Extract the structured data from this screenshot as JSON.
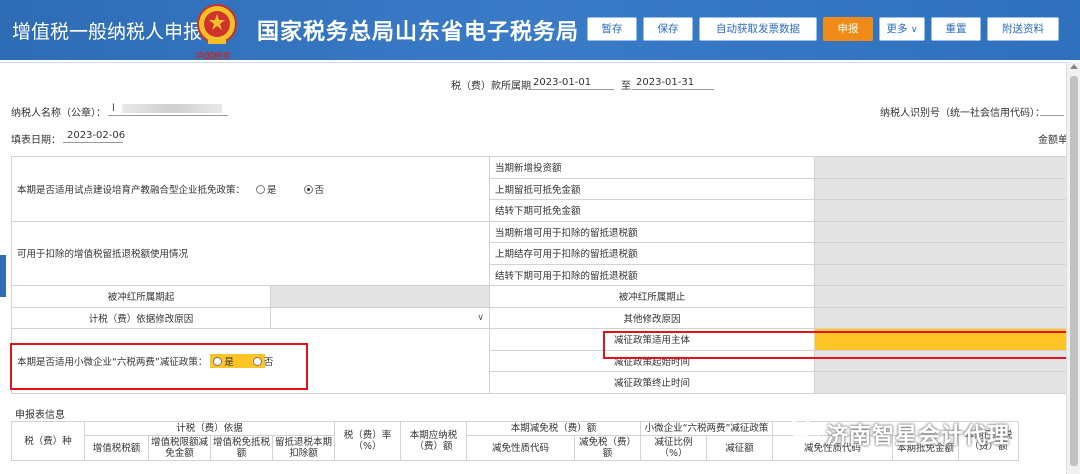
{
  "header": {
    "left_title": "增值税一般纳税人申报",
    "main_title": "国家税务总局山东省电子税务局",
    "emblem_caption": "中国税务",
    "buttons": {
      "tmp_save": "暂存",
      "save": "保存",
      "auto_invoice": "自动获取发票数据",
      "declare": "申报",
      "more": "更多",
      "reset": "重置",
      "attach": "附送资料"
    }
  },
  "info": {
    "period_label": "税（费）款所属期",
    "period_start": "2023-01-01",
    "period_to": "至",
    "period_end": "2023-01-31",
    "taxpayer_name_label": "纳税人名称（公章）：",
    "taxpayer_name_value": "l",
    "taxpayer_id_label": "纳税人识别号（统一社会信用代码）：",
    "fill_date_label": "填表日期：",
    "fill_date_value": "2023-02-06",
    "amount_unit": "金额单"
  },
  "table": {
    "r1_left": "本期是否适用试点建设培育产教融合型企业抵免政策：",
    "r1_yes": "是",
    "r1_no": "否",
    "r1_mid": "当期新增投资额",
    "r2_mid": "上期留抵可抵免金额",
    "r3_mid": "结转下期可抵免金额",
    "r4_left": "可用于扣除的增值税留抵退税额使用情况",
    "r4_mid": "当期新增可用于扣除的留抵退税额",
    "r5_mid": "上期结存可用于扣除的留抵退税额",
    "r6_mid": "结转下期可用于扣除的留抵退税额",
    "r7_left": "被冲红所属期起",
    "r7_mid": "被冲红所属期止",
    "r8_left": "计税（费）依据修改原因",
    "r8_mid": "其他修改原因",
    "r9_left": "本期是否适用小微企业“六税两费”减征政策：",
    "r9_yes": "是",
    "r9_no": "否",
    "r9_mid": "减征政策适用主体",
    "r10_mid": "减征政策起始时间",
    "r11_mid": "减征政策终止时间"
  },
  "section_title": "申报表信息",
  "lower": {
    "tax_type": "税（费）种",
    "basis": "计税（费）依据",
    "vat": "增值税税额",
    "vat_exempt": "增值税限额减免金额",
    "vat_offset": "增值税免抵税额",
    "refund_deduct": "留抵退税本期扣除额",
    "rate": "税（费）率（%）",
    "payable": "本期应纳税（费）额",
    "reduce": "本期减免税（费）额",
    "reduce_code": "减免性质代码",
    "reduce_amount": "减免税（费）额",
    "small_biz": "小微企业“六税两费”减征政策",
    "reduce_ratio": "减征比例（%）",
    "reduce_amt2": "减征额",
    "reduce_code2": "减免性质代码",
    "offset_amt": "本期抵免金额",
    "paid": "本期已缴税（费）额"
  },
  "watermark": "济南智星会计代理"
}
